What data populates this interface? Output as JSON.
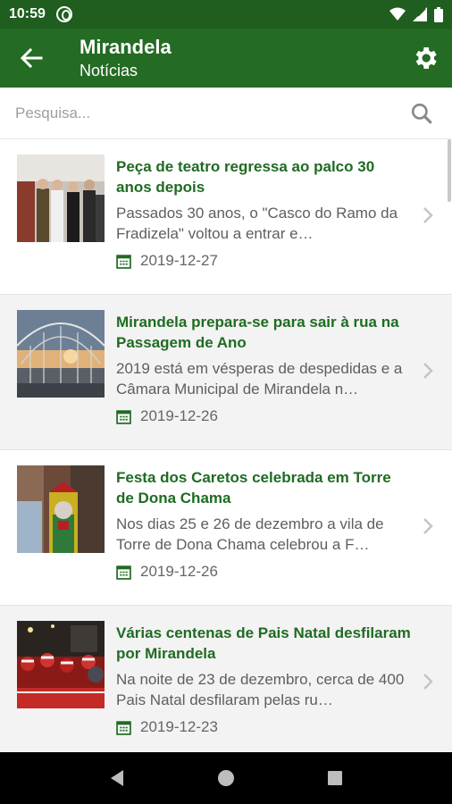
{
  "status": {
    "time": "10:59"
  },
  "appbar": {
    "title": "Mirandela",
    "subtitle": "Notícias"
  },
  "search": {
    "placeholder": "Pesquisa..."
  },
  "news": [
    {
      "title": "Peça de teatro regressa ao palco 30 anos depois",
      "excerpt": "Passados 30 anos, o \"Casco do Ramo da Fradizela\" voltou a entrar e…",
      "date": "2019-12-27"
    },
    {
      "title": "Mirandela prepara-se para sair à rua na Passagem de Ano",
      "excerpt": "2019 está em vésperas de despedidas e a Câmara Municipal de Mirandela n…",
      "date": "2019-12-26"
    },
    {
      "title": "Festa dos Caretos celebrada em Torre de Dona Chama",
      "excerpt": "Nos dias 25 e 26 de dezembro a vila de Torre de Dona Chama celebrou a F…",
      "date": "2019-12-26"
    },
    {
      "title": "Várias centenas de Pais Natal desfilaram por Mirandela",
      "excerpt": "Na noite de 23 de dezembro, cerca de 400 Pais Natal desfilaram pelas ru…",
      "date": "2019-12-23"
    }
  ],
  "colors": {
    "statusbar": "#1f5e1f",
    "appbar": "#246b24",
    "accent": "#1f6b22"
  },
  "icons": {
    "back": "arrow-back-icon",
    "settings": "gear-icon",
    "search": "search-icon",
    "date": "calendar-icon",
    "open": "chevron-right-icon"
  }
}
